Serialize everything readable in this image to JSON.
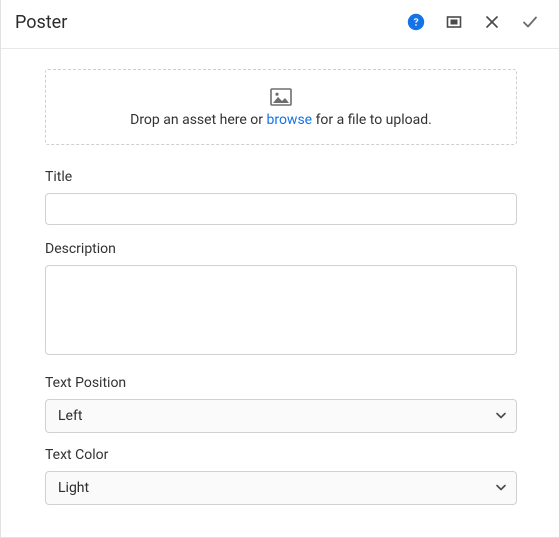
{
  "header": {
    "title": "Poster"
  },
  "dropzone": {
    "prefix": "Drop an asset here or ",
    "link": "browse",
    "suffix": " for a file to upload."
  },
  "fields": {
    "title": {
      "label": "Title",
      "value": ""
    },
    "description": {
      "label": "Description",
      "value": ""
    },
    "text_position": {
      "label": "Text Position",
      "value": "Left"
    },
    "text_color": {
      "label": "Text Color",
      "value": "Light"
    }
  }
}
